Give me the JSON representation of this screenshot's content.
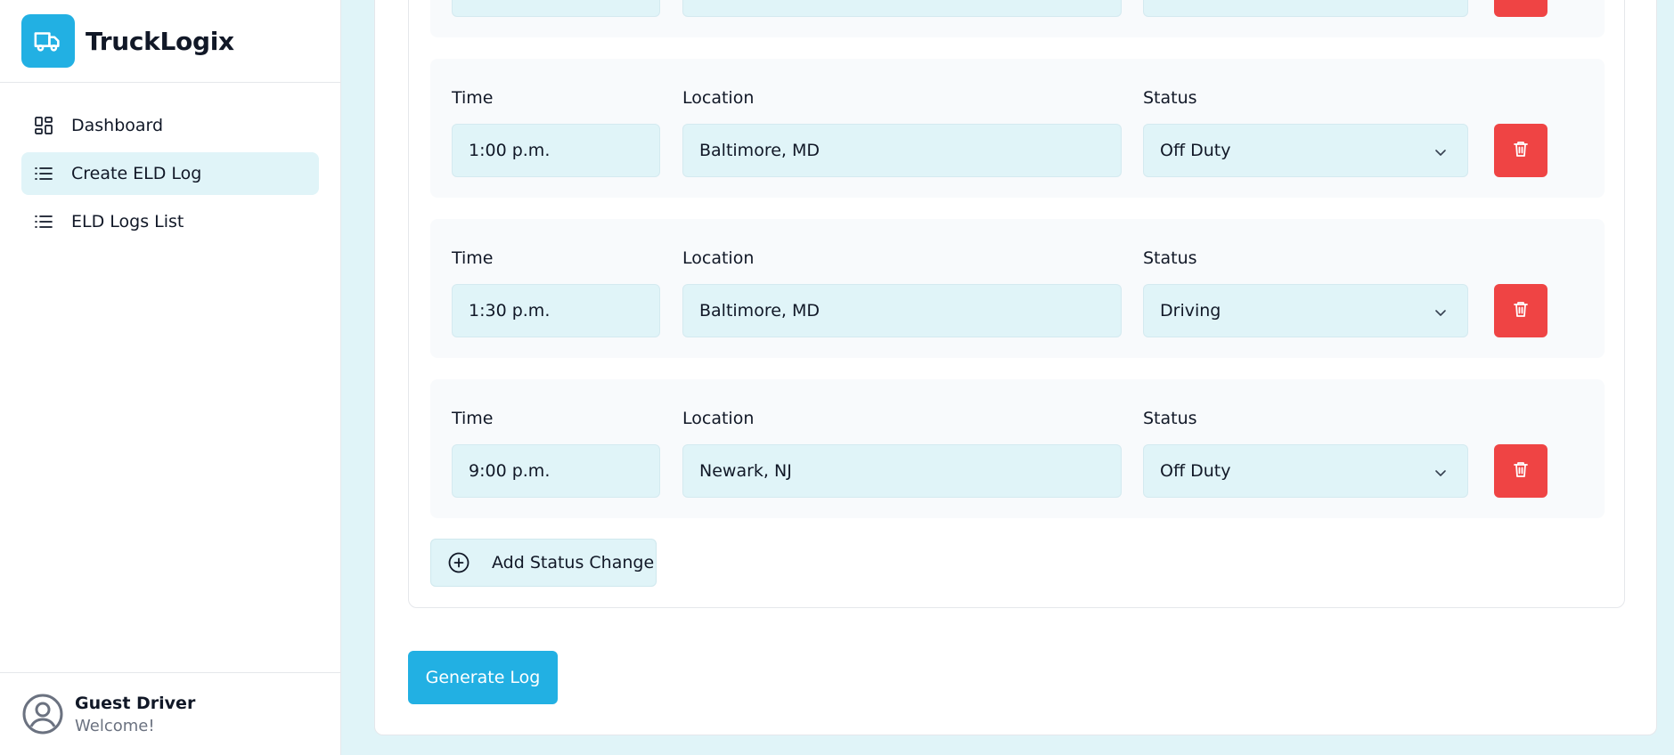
{
  "brand": {
    "name": "TruckLogix",
    "icon": "truck-icon"
  },
  "nav": [
    {
      "label": "Dashboard",
      "icon": "dashboard-icon",
      "active": false
    },
    {
      "label": "Create ELD Log",
      "icon": "list-icon",
      "active": true
    },
    {
      "label": "ELD Logs List",
      "icon": "list-icon",
      "active": false
    }
  ],
  "user": {
    "name": "Guest Driver",
    "subtitle": "Welcome!",
    "icon": "user-circle-icon"
  },
  "labels": {
    "time": "Time",
    "location": "Location",
    "status": "Status"
  },
  "entries": [
    {
      "time": "1:00 p.m.",
      "location": "Baltimore, MD",
      "status": "Off Duty"
    },
    {
      "time": "1:30 p.m.",
      "location": "Baltimore, MD",
      "status": "Driving"
    },
    {
      "time": "9:00 p.m.",
      "location": "Newark, NJ",
      "status": "Off Duty"
    }
  ],
  "actions": {
    "add_status_change": "Add Status Change",
    "generate_log": "Generate Log"
  },
  "colors": {
    "accent": "#22b0e3",
    "danger": "#ef4444",
    "field_bg": "#e0f4f8",
    "page_bg": "#e0f4f8"
  }
}
